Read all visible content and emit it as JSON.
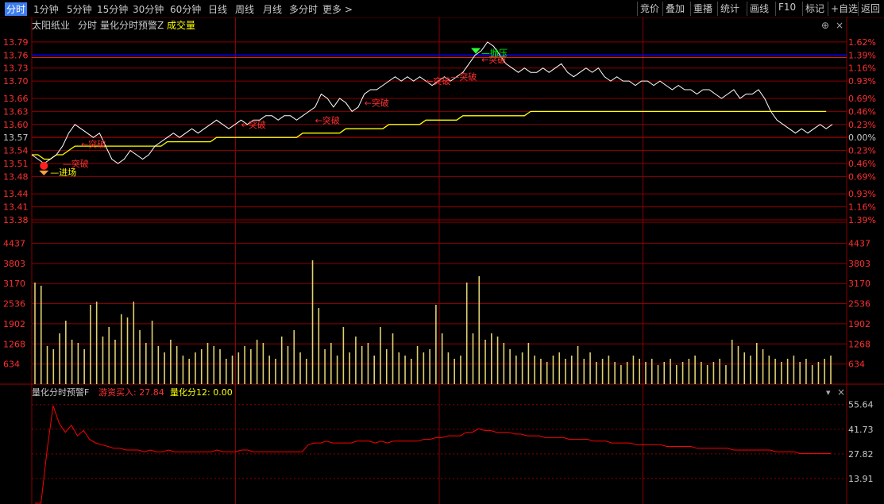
{
  "toolbar": {
    "tabs": [
      {
        "label": "分时",
        "active": true
      },
      {
        "label": "1分钟"
      },
      {
        "label": "5分钟"
      },
      {
        "label": "15分钟"
      },
      {
        "label": "30分钟"
      },
      {
        "label": "60分钟"
      },
      {
        "label": "日线"
      },
      {
        "label": "周线"
      },
      {
        "label": "月线"
      },
      {
        "label": "多分时"
      },
      {
        "label": "更多 >"
      }
    ],
    "right_buttons": [
      "竞价",
      "叠加",
      "重播",
      "统计",
      "画线",
      "F10",
      "标记",
      "+自选",
      "返回"
    ]
  },
  "header": {
    "stock_name": "太阳纸业",
    "mode": "分时",
    "indicator": "量化分时预警Z",
    "volume_label": "成交量"
  },
  "sub_header": {
    "name": "量化分时预警F",
    "item1": "游资买入: 27.84",
    "item2": "量化分12: 0.00"
  },
  "colors": {
    "price_line": "#ffffff",
    "avg_line": "#ffff00",
    "grid": "#8b0000",
    "up": "#ff3030",
    "down": "#00c000",
    "volume_bar": "#e0d070",
    "resistance": "#0000ff",
    "indicator_line": "#ff0000"
  },
  "chart_data": [
    {
      "type": "line",
      "panel": "price",
      "prev_close": 13.57,
      "ylim": [
        13.38,
        13.81
      ],
      "left_ticks": [
        "13.79",
        "13.76",
        "13.73",
        "13.70",
        "13.66",
        "13.63",
        "13.60",
        "13.57",
        "13.54",
        "13.51",
        "13.48",
        "13.44",
        "13.41",
        "13.38"
      ],
      "right_ticks": [
        "1.62%",
        "1.39%",
        "1.16%",
        "0.93%",
        "0.69%",
        "0.46%",
        "0.23%",
        "0.00%",
        "0.23%",
        "0.46%",
        "0.69%",
        "0.93%",
        "1.16%",
        "1.39%"
      ],
      "price": [
        13.53,
        13.52,
        13.51,
        13.52,
        13.53,
        13.55,
        13.58,
        13.6,
        13.59,
        13.58,
        13.57,
        13.58,
        13.55,
        13.52,
        13.51,
        13.52,
        13.54,
        13.53,
        13.52,
        13.53,
        13.55,
        13.56,
        13.57,
        13.58,
        13.57,
        13.58,
        13.59,
        13.58,
        13.59,
        13.6,
        13.61,
        13.6,
        13.59,
        13.6,
        13.61,
        13.6,
        13.61,
        13.61,
        13.62,
        13.62,
        13.61,
        13.62,
        13.62,
        13.61,
        13.62,
        13.63,
        13.64,
        13.67,
        13.66,
        13.64,
        13.66,
        13.65,
        13.63,
        13.64,
        13.67,
        13.68,
        13.68,
        13.69,
        13.7,
        13.71,
        13.7,
        13.71,
        13.7,
        13.71,
        13.7,
        13.69,
        13.7,
        13.71,
        13.7,
        13.71,
        13.72,
        13.74,
        13.76,
        13.77,
        13.79,
        13.78,
        13.76,
        13.74,
        13.73,
        13.72,
        13.73,
        13.72,
        13.72,
        13.73,
        13.72,
        13.73,
        13.74,
        13.72,
        13.71,
        13.72,
        13.73,
        13.72,
        13.73,
        13.71,
        13.7,
        13.71,
        13.7,
        13.7,
        13.69,
        13.7,
        13.7,
        13.69,
        13.7,
        13.69,
        13.68,
        13.69,
        13.68,
        13.68,
        13.67,
        13.68,
        13.68,
        13.67,
        13.66,
        13.67,
        13.68,
        13.66,
        13.67,
        13.67,
        13.68,
        13.66,
        13.63,
        13.61,
        13.6,
        13.59,
        13.58,
        13.59,
        13.58,
        13.59,
        13.6,
        13.59,
        13.6
      ],
      "avg": [
        13.53,
        13.53,
        13.52,
        13.52,
        13.53,
        13.53,
        13.54,
        13.55,
        13.55,
        13.55,
        13.55,
        13.55,
        13.55,
        13.55,
        13.55,
        13.55,
        13.55,
        13.55,
        13.55,
        13.55,
        13.55,
        13.55,
        13.56,
        13.56,
        13.56,
        13.56,
        13.56,
        13.56,
        13.56,
        13.56,
        13.57,
        13.57,
        13.57,
        13.57,
        13.57,
        13.57,
        13.57,
        13.57,
        13.57,
        13.57,
        13.57,
        13.57,
        13.57,
        13.57,
        13.58,
        13.58,
        13.58,
        13.58,
        13.58,
        13.58,
        13.58,
        13.59,
        13.59,
        13.59,
        13.59,
        13.59,
        13.59,
        13.59,
        13.6,
        13.6,
        13.6,
        13.6,
        13.6,
        13.6,
        13.61,
        13.61,
        13.61,
        13.61,
        13.61,
        13.61,
        13.62,
        13.62,
        13.62,
        13.62,
        13.62,
        13.62,
        13.62,
        13.62,
        13.62,
        13.62,
        13.62,
        13.63,
        13.63,
        13.63,
        13.63,
        13.63,
        13.63,
        13.63,
        13.63,
        13.63,
        13.63,
        13.63,
        13.63,
        13.63,
        13.63,
        13.63,
        13.63,
        13.63,
        13.63,
        13.63,
        13.63,
        13.63,
        13.63,
        13.63,
        13.63,
        13.63,
        13.63,
        13.63,
        13.63,
        13.63,
        13.63,
        13.63,
        13.63,
        13.63,
        13.63,
        13.63,
        13.63,
        13.63,
        13.63,
        13.63,
        13.63,
        13.63,
        13.63,
        13.63,
        13.63,
        13.63,
        13.63,
        13.63,
        13.63,
        13.63
      ],
      "resistance_value": 13.76,
      "annotations": [
        {
          "text": "—进场",
          "index": 3,
          "value": 13.49,
          "color": "#ffff00"
        },
        {
          "text": "—突破",
          "index": 5,
          "value": 13.51,
          "color": "#ff3030"
        },
        {
          "text": "←突破",
          "index": 8,
          "value": 13.555,
          "color": "#ff3030"
        },
        {
          "text": "←突破",
          "index": 34,
          "value": 13.6,
          "color": "#ff3030"
        },
        {
          "text": "←突破",
          "index": 46,
          "value": 13.61,
          "color": "#ff3030"
        },
        {
          "text": "←突破",
          "index": 54,
          "value": 13.65,
          "color": "#ff3030"
        },
        {
          "text": "←突破",
          "index": 64,
          "value": 13.7,
          "color": "#ff3030"
        },
        {
          "text": "—突破",
          "index": 68,
          "value": 13.71,
          "color": "#ff3030"
        },
        {
          "text": "←突破",
          "index": 73,
          "value": 13.75,
          "color": "#ff3030"
        },
        {
          "text": "—抛压",
          "index": 73,
          "value": 13.765,
          "color": "#00ff00"
        }
      ]
    },
    {
      "type": "bar",
      "panel": "volume",
      "ylim": [
        0,
        4800
      ],
      "left_ticks": [
        "4437",
        "3803",
        "3170",
        "2536",
        "1902",
        "1268",
        "634"
      ],
      "right_ticks": [
        "4437",
        "3803",
        "3170",
        "2536",
        "1902",
        "1268",
        "634"
      ],
      "values": [
        3200,
        3100,
        1200,
        1100,
        1600,
        2000,
        1400,
        1300,
        1100,
        2500,
        2600,
        1500,
        1800,
        1400,
        2200,
        2100,
        2600,
        1700,
        1300,
        2000,
        1200,
        1000,
        1400,
        1200,
        900,
        800,
        1000,
        1100,
        1300,
        1200,
        1100,
        800,
        900,
        1000,
        1200,
        1100,
        1400,
        1300,
        900,
        800,
        1500,
        1200,
        1700,
        1000,
        800,
        3900,
        2400,
        1100,
        1300,
        900,
        1800,
        1000,
        1500,
        1200,
        1300,
        900,
        1800,
        1100,
        1600,
        1000,
        900,
        800,
        1200,
        1000,
        1100,
        2500,
        1600,
        1000,
        800,
        900,
        3200,
        1600,
        3400,
        1400,
        1600,
        1500,
        1300,
        1100,
        900,
        1000,
        1300,
        900,
        800,
        700,
        900,
        1000,
        800,
        900,
        1200,
        800,
        1000,
        700,
        800,
        900,
        700,
        600,
        700,
        900,
        800,
        700,
        800,
        600,
        700,
        800,
        600,
        700,
        800,
        900,
        700,
        600,
        700,
        800,
        600,
        1400,
        1200,
        1000,
        900,
        1300,
        1100,
        900,
        800,
        700,
        800,
        900,
        700,
        800,
        600,
        700,
        800,
        900
      ]
    },
    {
      "type": "line",
      "panel": "indicator",
      "ylim": [
        0,
        60
      ],
      "right_ticks": [
        "55.64",
        "41.73",
        "27.82",
        "13.91"
      ],
      "values": [
        0,
        0,
        30,
        55,
        45,
        40,
        44,
        38,
        41,
        36,
        34,
        33,
        32,
        31,
        31,
        30,
        30,
        30,
        29,
        30,
        29,
        29,
        30,
        29,
        29,
        29,
        29,
        29,
        29,
        29,
        30,
        29,
        29,
        29,
        30,
        30,
        29,
        29,
        29,
        29,
        29,
        29,
        29,
        29,
        29,
        33,
        34,
        34,
        35,
        34,
        34,
        34,
        34,
        35,
        35,
        35,
        34,
        35,
        34,
        35,
        35,
        35,
        35,
        35,
        36,
        36,
        37,
        37,
        38,
        38,
        38,
        40,
        40,
        42,
        41,
        41,
        40,
        40,
        40,
        39,
        39,
        38,
        38,
        38,
        37,
        37,
        37,
        37,
        36,
        36,
        36,
        36,
        35,
        35,
        35,
        34,
        34,
        34,
        34,
        33,
        33,
        33,
        33,
        33,
        32,
        32,
        32,
        32,
        32,
        31,
        31,
        31,
        31,
        31,
        31,
        30,
        30,
        30,
        30,
        30,
        30,
        30,
        29,
        29,
        29,
        29,
        28,
        28,
        28,
        28,
        28,
        28
      ]
    }
  ]
}
